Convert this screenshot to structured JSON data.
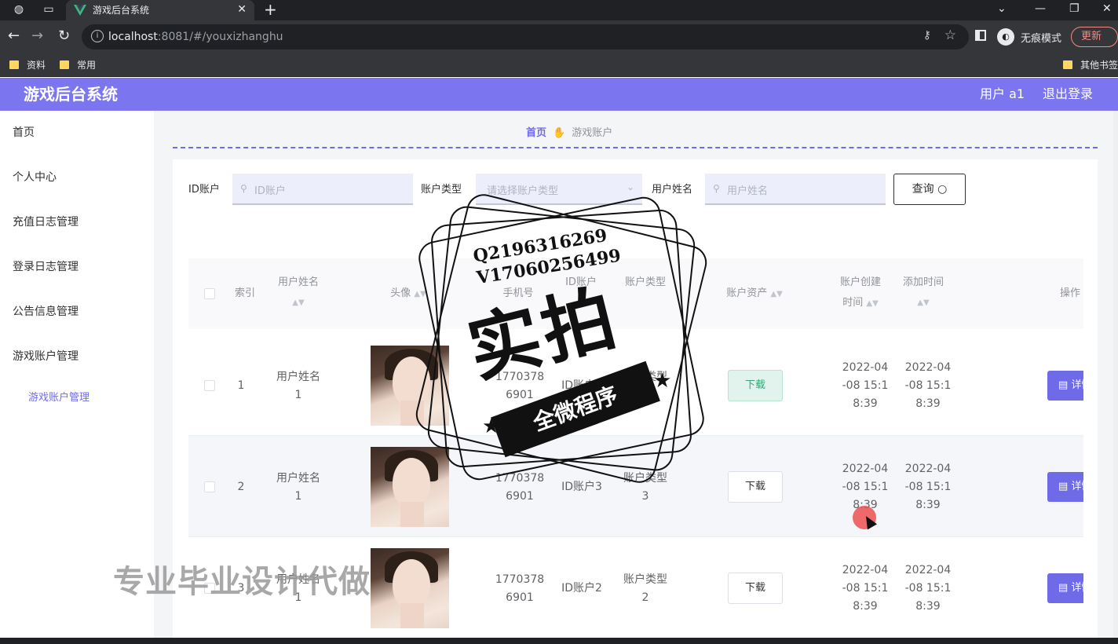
{
  "browser": {
    "tab_title": "游戏后台系统",
    "tab_close": "✕",
    "new_tab": "+",
    "url_host": "localhost",
    "url_rest": ":8081/#/youxizhanghu",
    "incognito_label": "无痕模式",
    "update_label": "更新",
    "bookmarks": [
      "资料",
      "常用",
      "其他书签"
    ]
  },
  "header": {
    "title": "游戏后台系统",
    "user": "用户 a1",
    "logout": "退出登录"
  },
  "sidebar": {
    "items": [
      "首页",
      "个人中心",
      "充值日志管理",
      "登录日志管理",
      "公告信息管理",
      "游戏账户管理"
    ],
    "sub_item": "游戏账户管理"
  },
  "breadcrumb": {
    "home": "首页",
    "current": "游戏账户"
  },
  "search": {
    "id_label": "ID账户",
    "id_placeholder": "ID账户",
    "type_label": "账户类型",
    "type_placeholder": "请选择账户类型",
    "name_label": "用户姓名",
    "name_placeholder": "用户姓名",
    "query_button": "查询"
  },
  "table": {
    "headers": {
      "index": "索引",
      "name": "用户姓名",
      "avatar": "头像",
      "phone": "手机号",
      "id_account": "ID账户",
      "type": "账户类型",
      "assets": "账户资产",
      "created_a": "账户创建",
      "created_b": "时间",
      "added": "添加时间",
      "actions": "操作"
    },
    "rows": [
      {
        "index": "1",
        "name_a": "用户姓名",
        "name_b": "1",
        "phone_a": "1770378",
        "phone_b": "6901",
        "id_account": "ID账户4",
        "type_a": "账户类型",
        "type_b": "4",
        "download": "下载",
        "created_a": "2022-04",
        "created_b": "-08 15:1",
        "created_c": "8:39",
        "added_a": "2022-04",
        "added_b": "-08 15:1",
        "added_c": "8:39",
        "detail": "详情"
      },
      {
        "index": "2",
        "name_a": "用户姓名",
        "name_b": "1",
        "phone_a": "1770378",
        "phone_b": "6901",
        "id_account": "ID账户3",
        "type_a": "账户类型",
        "type_b": "3",
        "download": "下载",
        "created_a": "2022-04",
        "created_b": "-08 15:1",
        "created_c": "8:39",
        "added_a": "2022-04",
        "added_b": "-08 15:1",
        "added_c": "8:39",
        "detail": "详情"
      },
      {
        "index": "3",
        "name_a": "用户姓名",
        "name_b": "1",
        "phone_a": "1770378",
        "phone_b": "6901",
        "id_account": "ID账户2",
        "type_a": "账户类型",
        "type_b": "2",
        "download": "下载",
        "created_a": "2022-04",
        "created_b": "-08 15:1",
        "created_c": "8:39",
        "added_a": "2022-04",
        "added_b": "-08 15:1",
        "added_c": "8:39",
        "detail": "详情"
      }
    ]
  },
  "watermark": {
    "qq": "Q2196316269",
    "wechat": "V17060256499",
    "big": "实拍",
    "ribbon": "全微程序",
    "bottom_text": "专业毕业设计代做"
  },
  "colors": {
    "header_bg": "#7b75f0",
    "accent": "#6f6be8",
    "download_active_bg": "#e1f3ec"
  }
}
